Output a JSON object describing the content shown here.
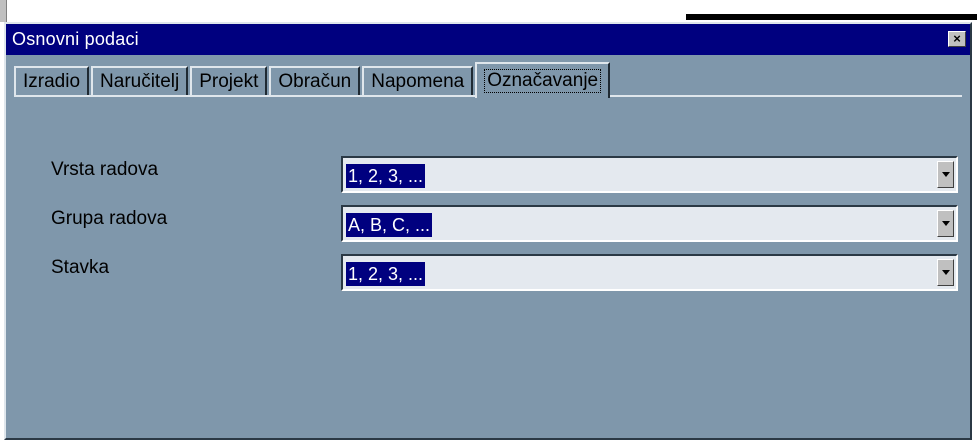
{
  "window": {
    "title": "Osnovni podaci",
    "close_glyph": "×"
  },
  "tabs": [
    {
      "label": "Izradio"
    },
    {
      "label": "Naručitelj"
    },
    {
      "label": "Projekt"
    },
    {
      "label": "Obračun"
    },
    {
      "label": "Napomena"
    },
    {
      "label": "Označavanje"
    }
  ],
  "active_tab": "Označavanje",
  "fields": [
    {
      "label": "Vrsta radova",
      "value": "1, 2, 3, ..."
    },
    {
      "label": "Grupa radova",
      "value": "A, B, C, ..."
    },
    {
      "label": "Stavka",
      "value": "1, 2, 3, ..."
    }
  ],
  "colors": {
    "titlebar": "#00007f",
    "window_bg": "#7f97ab",
    "selection": "#00007f",
    "combo_bg": "#e4e9ef"
  }
}
